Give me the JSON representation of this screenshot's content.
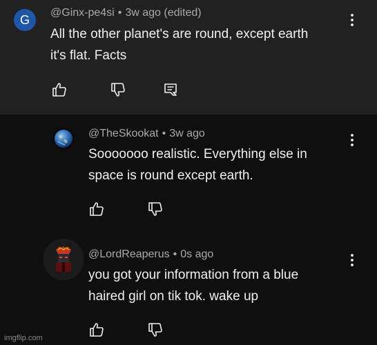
{
  "comment_main": {
    "avatar_letter": "G",
    "username": "@Ginx-pe4si",
    "separator": "•",
    "time": "3w ago (edited)",
    "text_line1": "All the other planet's are round, except earth",
    "text_line2": "it's flat. Facts",
    "avatar_color": "#1f57a8"
  },
  "reply_1": {
    "username": "@TheSkookat",
    "separator": "•",
    "time": "3w ago",
    "text_line1": "Sooooooo realistic. Everything else in",
    "text_line2": "space is round except earth."
  },
  "reply_2": {
    "username": "@LordReaperus",
    "separator": "•",
    "time": "0s ago",
    "text_line1": "you got your information from a blue",
    "text_line2": "haired girl on tik tok. wake up"
  },
  "watermark": "imgflip.com",
  "icons": {
    "like": "thumbs-up-icon",
    "dislike": "thumbs-down-icon",
    "reply": "reply-icon",
    "menu": "more-vertical-icon"
  },
  "colors": {
    "top_background": "#212121",
    "page_background": "#0f0f0f",
    "meta_text": "#aaaaaa",
    "body_text": "#f1f1f1"
  }
}
